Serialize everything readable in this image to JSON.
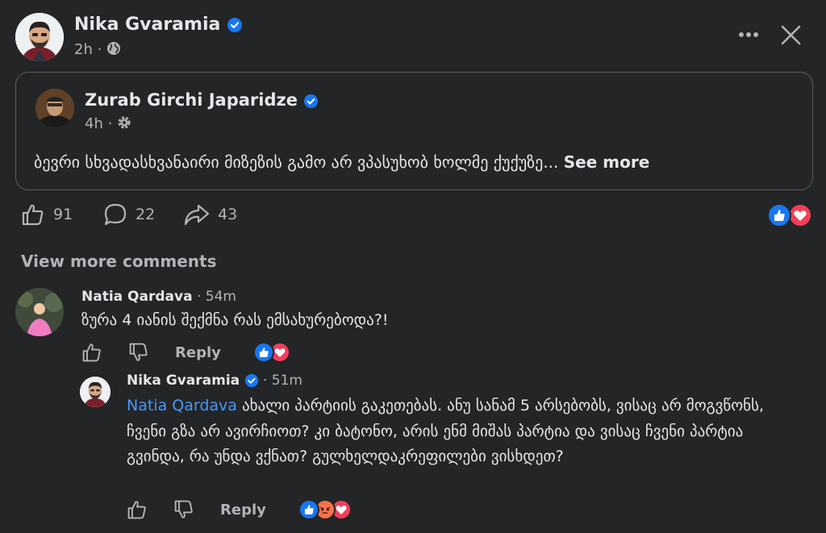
{
  "post": {
    "author": "Nika Gvaramia",
    "time": "2h",
    "audience_icon": "globe-icon"
  },
  "shared_post": {
    "author": "Zurab Girchi Japaridze",
    "time": "4h",
    "audience_icon": "gear-icon",
    "text": "ბევრი სხვადასხვანაირი მიზეზის გამო არ ვპასუხობ ხოლმე ქუქუზე...",
    "see_more": "See more"
  },
  "stats": {
    "likes": "91",
    "comments": "22",
    "shares": "43",
    "reactions": [
      "like",
      "love"
    ]
  },
  "view_more_comments": "View more comments",
  "comments": [
    {
      "author": "Natia Qardava",
      "time": "54m",
      "text": "ზურა 4 იანის შექმნა რას ემსახურებოდა?!",
      "reply_label": "Reply",
      "reactions": [
        "like",
        "love"
      ]
    },
    {
      "author": "Nika Gvaramia",
      "time": "51m",
      "mention": "Natia Qardava",
      "text": "ახალი პარტიის გაკეთებას. ანუ სანამ 5 არსებობს, ვისაც არ მოგვწონს, ჩვენი გზა არ ავირჩიოთ? კი ბატონო, არის ენმ მიშას პარტია და ვისაც ჩვენი პარტია გვინდა, რა უნდა ვქნათ? გულხელდაკრეფილები ვისხდეთ?",
      "reply_label": "Reply",
      "reactions": [
        "like",
        "angry",
        "love"
      ]
    }
  ],
  "colors": {
    "background": "#242526",
    "accent": "#1877f2",
    "love": "#f33e58",
    "angry": "#f7714b",
    "mention": "#4599ff"
  }
}
